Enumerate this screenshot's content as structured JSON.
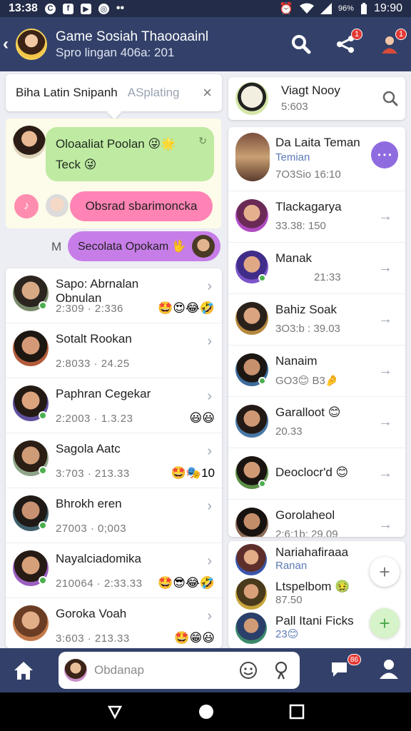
{
  "status_bar": {
    "time_left": "13:38",
    "time_right": "19:90",
    "battery": "96%"
  },
  "header": {
    "title": "Game Sosiah Thaooaainl",
    "subtitle": "Spro lingan 406a: 201"
  },
  "header_badges": {
    "notifications": "1",
    "alerts": "1"
  },
  "search_card": {
    "query": "Biha Latin Snipanh",
    "placeholder": "ASplating"
  },
  "chat": {
    "green_line1": "Oloaaliat Poolan 😜🌟",
    "green_line2": "Teck 😜",
    "pink_text": "Obsrad sbarimoncka",
    "m_letter": "M",
    "purple_text": "Secolata Opokam 🖖"
  },
  "left_list": [
    {
      "name": "Sapo: Abrnalan Obnulan",
      "meta": "2:309 · 2:336",
      "emoji": "🤩😍😂🤣"
    },
    {
      "name": "Sotalt Rookan",
      "meta": "2:8033 · 24.25",
      "emoji": ""
    },
    {
      "name": "Paphran Cegekar",
      "meta": "2:2003 · 1.3.23",
      "emoji": "😃😃"
    },
    {
      "name": "Sagola Aatc",
      "meta": "3:703 · 213.33",
      "emoji": "🤩🎭10"
    },
    {
      "name": "Bhrokh eren",
      "meta": "27003 · 0;003",
      "emoji": ""
    },
    {
      "name": "Nayalciadomika",
      "meta": "210064 · 2:33.33",
      "emoji": "🤩😎😂🤣"
    },
    {
      "name": "Goroka Voah",
      "meta": "3:603 · 213.33",
      "emoji": "🤩😁😃"
    }
  ],
  "top_card": {
    "name": "Viagt Nooy",
    "meta": "5:603"
  },
  "right_list": [
    {
      "name": "Da Laita Teman",
      "sub": "Temian",
      "meta": "7O3Sio 16:10",
      "pill": "• • •"
    },
    {
      "name": "Tlackagarya",
      "meta": "33.38: 150"
    },
    {
      "name": "Manak",
      "meta": "21:33"
    },
    {
      "name": "Bahiz Soak",
      "meta": "3O3:b : 39.03"
    },
    {
      "name": "Nanaim",
      "meta": "GO3😊 B3🤌"
    },
    {
      "name": "Garalloot 😊",
      "meta": "20.33"
    },
    {
      "name": "Deoclocr'd 😊",
      "meta": ""
    },
    {
      "name": "Gorolaheol",
      "meta": "2:6:1b: 29.09"
    }
  ],
  "bottom_card": [
    {
      "name": "Nariahafiraaa",
      "sub": "Ranan"
    },
    {
      "name": "Ltspelbom 🤢",
      "sub": "87.50"
    },
    {
      "name": "Pall Itani Ficks",
      "sub": "23😊"
    }
  ],
  "bottom_bar": {
    "placeholder": "Obdanap",
    "chat_badge": "86"
  },
  "colors": {
    "header": "#33416a",
    "status_bar": "#232c48",
    "accent_purple": "#8f6be0",
    "online": "#4caf50",
    "badge": "#e53935"
  }
}
